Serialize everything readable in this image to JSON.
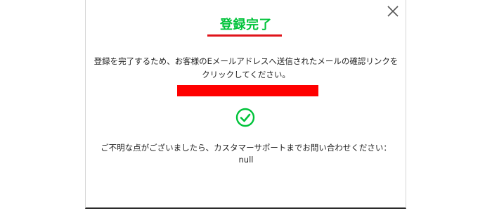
{
  "dialog": {
    "title": "登録完了",
    "message": "登録を完了するため、お客様のEメールアドレスへ送信されたメールの確認リンクをクリックしてください。",
    "close_icon": "close-icon",
    "status_icon": "check-circle-icon",
    "support_text": "ご不明な点がございましたら、カスタマーサポートまでお問い合わせください：",
    "support_contact": "null"
  },
  "colors": {
    "title": "#00c33a",
    "title_underline": "#e0141a",
    "check": "#00c33a",
    "redaction": "#ff0000"
  }
}
